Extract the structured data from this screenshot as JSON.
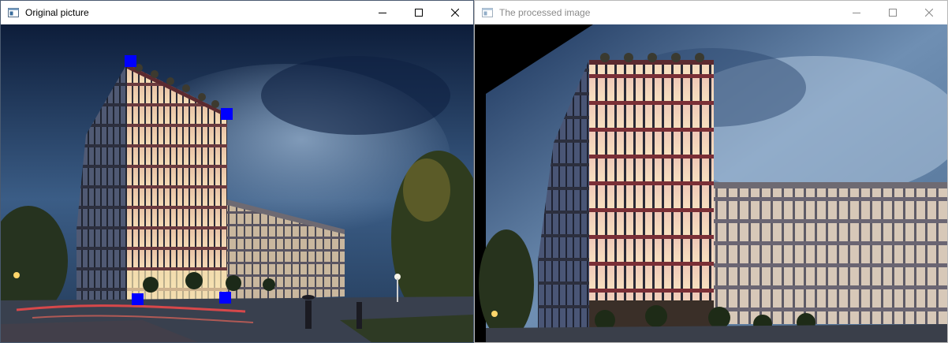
{
  "windows": {
    "original": {
      "title": "Original picture",
      "controls": [
        "minimize-icon",
        "maximize-icon",
        "close-icon"
      ],
      "corner_handles": [
        "top-left",
        "top-right",
        "bottom-left",
        "bottom-right"
      ]
    },
    "processed": {
      "title": "The processed image",
      "controls": [
        "minimize-icon",
        "maximize-icon",
        "close-icon"
      ]
    }
  },
  "colors": {
    "handle": "#0000ff",
    "titlebar_active_text": "#000000",
    "titlebar_inactive_text": "#8a8a8a",
    "sky_top": "#0d1d3a",
    "sky_light": "#6f8fb3",
    "window_glow": "#f2c9a0"
  }
}
